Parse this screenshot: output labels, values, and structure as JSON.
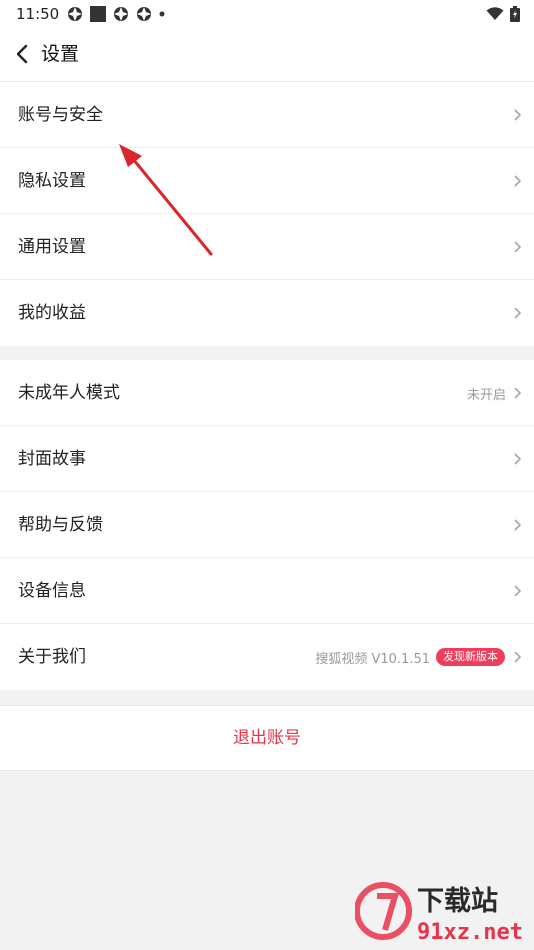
{
  "status": {
    "time": "11:50"
  },
  "header": {
    "title": "设置"
  },
  "group1": [
    {
      "label": "账号与安全"
    },
    {
      "label": "隐私设置"
    },
    {
      "label": "通用设置"
    },
    {
      "label": "我的收益"
    }
  ],
  "group2": [
    {
      "label": "未成年人模式",
      "value": "未开启"
    },
    {
      "label": "封面故事"
    },
    {
      "label": "帮助与反馈"
    },
    {
      "label": "设备信息"
    },
    {
      "label": "关于我们",
      "value": "搜狐视频 V10.1.51",
      "badge": "发现新版本"
    }
  ],
  "logout_label": "退出账号",
  "colors": {
    "accent": "#e8344a",
    "badge": "#ef3e5c",
    "annotation": "#d9262c"
  },
  "watermark": {
    "logo_text": "下载站",
    "url_text": "91xz.net"
  }
}
